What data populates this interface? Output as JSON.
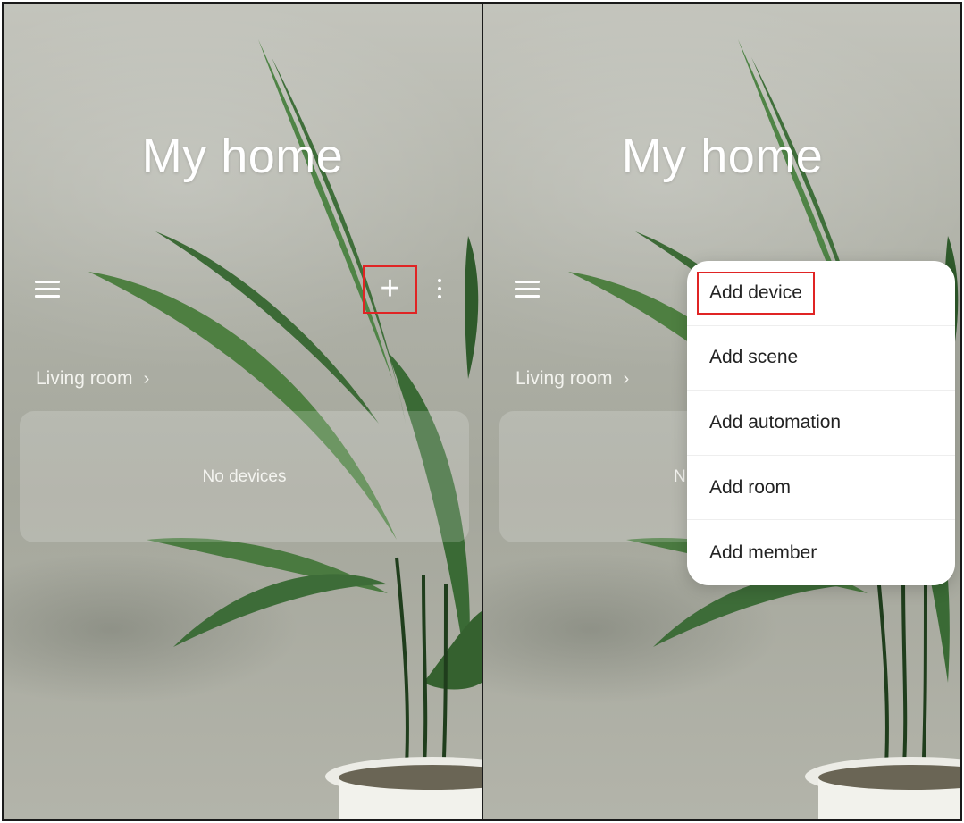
{
  "left_screen": {
    "title": "My home",
    "room_label": "Living room",
    "chevron": "›",
    "empty_state": "No devices",
    "add_button_glyph": "+",
    "icons": [
      "menu-icon",
      "plus-icon",
      "more-vert-icon",
      "chevron-right-icon"
    ]
  },
  "right_screen": {
    "title": "My home",
    "room_label": "Living room",
    "chevron": "›",
    "empty_state_partial": "N",
    "menu": {
      "items": [
        {
          "label": "Add device"
        },
        {
          "label": "Add scene"
        },
        {
          "label": "Add automation"
        },
        {
          "label": "Add room"
        },
        {
          "label": "Add member"
        }
      ]
    }
  },
  "colors": {
    "highlight_box": "#e02424",
    "title_text": "#ffffff",
    "menu_background": "#ffffff",
    "menu_text": "#222222"
  }
}
